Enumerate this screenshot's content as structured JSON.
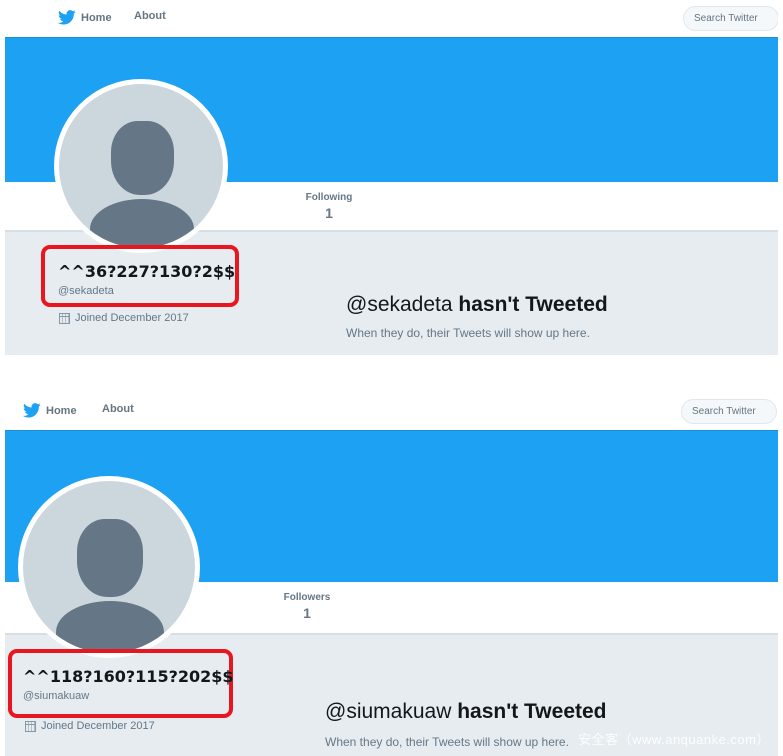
{
  "nav": {
    "home_label": "Home",
    "about_label": "About",
    "search_placeholder": "Search Twitter",
    "home_icon": "twitter-bird-icon"
  },
  "colors": {
    "brand_blue": "#1da1f2",
    "highlight_red": "#e8161f",
    "content_gray": "#e6ecf0",
    "text_gray": "#657786"
  },
  "profiles": [
    {
      "stat_label": "Following",
      "stat_value": "1",
      "display_name": "^^36?227?130?2$$",
      "screen_name": "@sekadeta",
      "joined": "Joined December 2017",
      "empty_handle": "@sekadeta",
      "empty_suffix": "hasn't Tweeted",
      "empty_sub": "When they do, their Tweets will show up here."
    },
    {
      "stat_label": "Followers",
      "stat_value": "1",
      "display_name": "^^118?160?115?202$$",
      "screen_name": "@siumakuaw",
      "joined": "Joined December 2017",
      "empty_handle": "@siumakuaw",
      "empty_suffix": "hasn't Tweeted",
      "empty_sub": "When they do, their Tweets will show up here."
    }
  ],
  "watermark": "安全客（www.anquanke.com）"
}
